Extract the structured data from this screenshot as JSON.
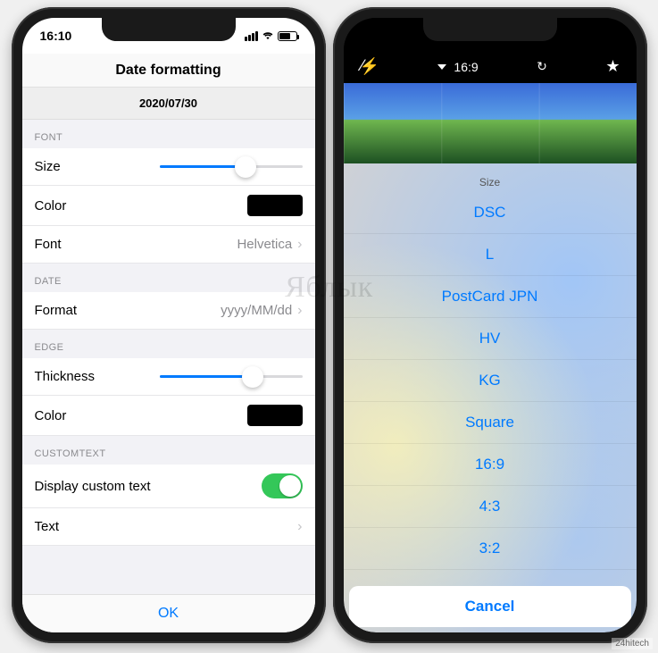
{
  "watermark": "Яблык",
  "credit": "24hitech",
  "left": {
    "status_time": "16:10",
    "navbar_title": "Date formatting",
    "preview_value": "2020/07/30",
    "sections": {
      "font": {
        "header": "FONT",
        "size_label": "Size",
        "size_percent": 60,
        "color_label": "Color",
        "color_value": "#000000",
        "font_label": "Font",
        "font_value": "Helvetica"
      },
      "date": {
        "header": "DATE",
        "format_label": "Format",
        "format_value": "yyyy/MM/dd"
      },
      "edge": {
        "header": "EDGE",
        "thickness_label": "Thickness",
        "thickness_percent": 65,
        "color_label": "Color",
        "color_value": "#000000"
      },
      "custom": {
        "header": "CUSTOMTEXT",
        "toggle_label": "Display custom text",
        "toggle_on": true,
        "text_label": "Text"
      }
    },
    "ok_label": "OK"
  },
  "right": {
    "toolbar": {
      "flash": "off",
      "aspect_label": "16:9"
    },
    "sheet": {
      "title": "Size",
      "items": [
        "DSC",
        "L",
        "PostCard JPN",
        "HV",
        "KG",
        "Square",
        "16:9",
        "4:3",
        "3:2"
      ],
      "cancel": "Cancel"
    }
  }
}
